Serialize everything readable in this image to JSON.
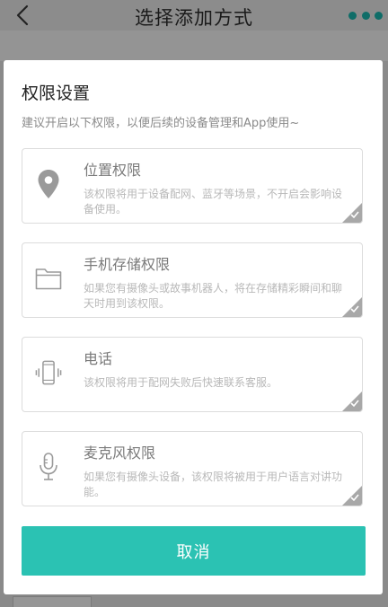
{
  "appbar": {
    "title": "选择添加方式"
  },
  "dialog": {
    "title": "权限设置",
    "subtitle": "建议开启以下权限，以便后续的设备管理和App使用~",
    "permissions": [
      {
        "icon": "location-pin-icon",
        "title": "位置权限",
        "description": "该权限将用于设备配网、蓝牙等场景，不开启会影响设备使用。"
      },
      {
        "icon": "folder-icon",
        "title": "手机存储权限",
        "description": "如果您有摄像头或故事机器人，将在存储精彩瞬间和聊天时用到该权限。"
      },
      {
        "icon": "phone-vibrate-icon",
        "title": "电话",
        "description": "该权限将用于配网失败后快速联系客服。"
      },
      {
        "icon": "microphone-icon",
        "title": "麦克风权限",
        "description": "如果您有摄像头设备，该权限将被用于用户语言对讲功能。"
      }
    ],
    "cancel_label": "取消"
  },
  "colors": {
    "accent": "#2bc2b3",
    "overflow_dots": "#0f6d68",
    "overlay": "#8a8a8a"
  }
}
